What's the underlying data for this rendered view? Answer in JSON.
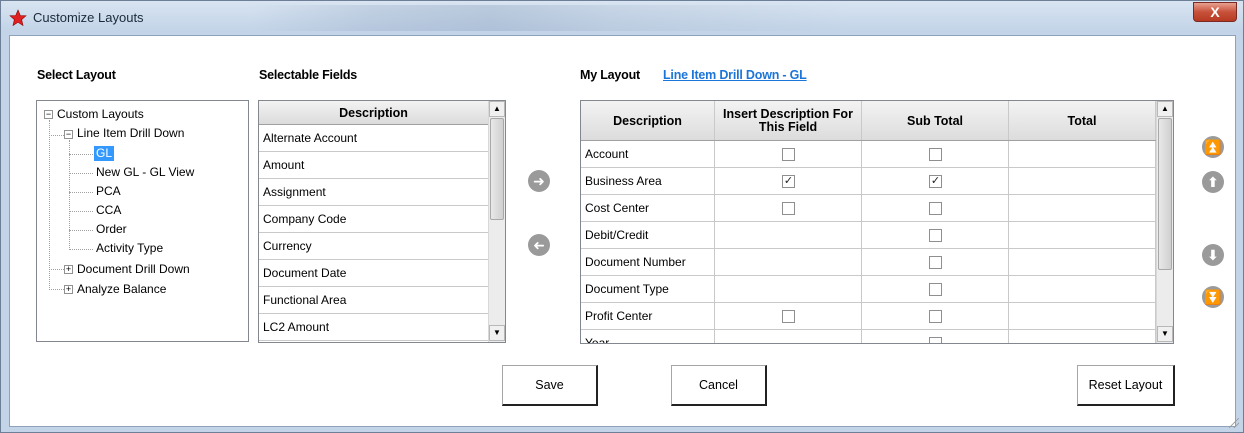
{
  "window": {
    "title": "Customize Layouts",
    "close_label": "X"
  },
  "headers": {
    "select_layout": "Select Layout",
    "selectable_fields": "Selectable Fields",
    "my_layout": "My Layout",
    "my_layout_link": "Line Item Drill Down - GL"
  },
  "tree": {
    "root": "Custom Layouts",
    "group1": "Line Item Drill Down",
    "children": [
      "GL",
      "New GL - GL View",
      "PCA",
      "CCA",
      "Order",
      "Activity Type"
    ],
    "group2": "Document Drill Down",
    "group3": "Analyze Balance",
    "selected": "GL"
  },
  "fields": {
    "header": "Description",
    "items": [
      "Alternate Account",
      "Amount",
      "Assignment",
      "Company Code",
      "Currency",
      "Document Date",
      "Functional Area",
      "LC2 Amount"
    ]
  },
  "layout": {
    "columns": [
      "Description",
      "Insert Description For This Field",
      "Sub Total",
      "Total"
    ],
    "rows": [
      {
        "label": "Account",
        "insert": "unchecked",
        "subtotal": "unchecked"
      },
      {
        "label": "Business Area",
        "insert": "checked",
        "subtotal": "checked"
      },
      {
        "label": "Cost Center",
        "insert": "unchecked",
        "subtotal": "unchecked"
      },
      {
        "label": "Debit/Credit",
        "insert": "none",
        "subtotal": "unchecked"
      },
      {
        "label": "Document Number",
        "insert": "none",
        "subtotal": "unchecked"
      },
      {
        "label": "Document Type",
        "insert": "none",
        "subtotal": "unchecked"
      },
      {
        "label": "Profit Center",
        "insert": "unchecked",
        "subtotal": "unchecked"
      },
      {
        "label": "Year",
        "insert": "none",
        "subtotal": "unchecked"
      }
    ]
  },
  "buttons": {
    "save": "Save",
    "cancel": "Cancel",
    "reset": "Reset Layout"
  },
  "icons": {
    "move_right": "arrow-right-icon",
    "move_left": "arrow-left-icon",
    "move_top": "double-up-icon",
    "move_up": "arrow-up-icon",
    "move_down": "arrow-down-icon",
    "move_bottom": "double-down-icon"
  },
  "colors": {
    "accent": "#1c75d8",
    "selection": "#3399ff",
    "close": "#c7513a"
  }
}
